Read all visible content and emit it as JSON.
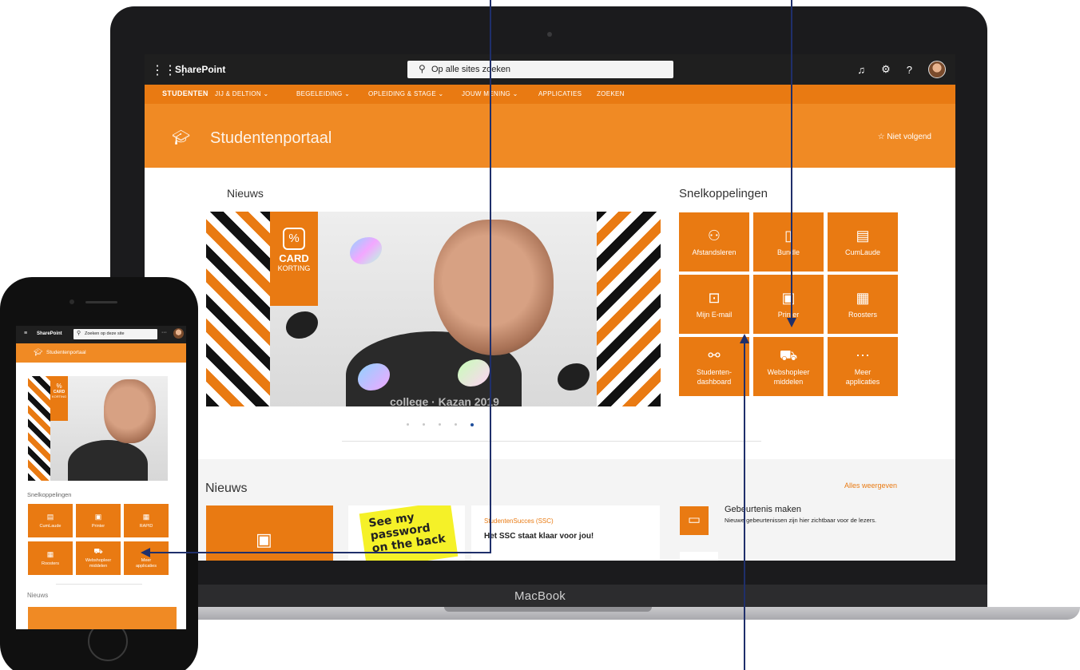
{
  "laptop": {
    "brand_label": "MacBook",
    "suitebar": {
      "waffle_icon": "waffle-icon",
      "app_name": "SharePoint",
      "search_placeholder": "Op alle sites zoeken",
      "icons": [
        "bell-icon",
        "gear-icon",
        "help-icon",
        "avatar"
      ]
    },
    "nav": {
      "items": [
        "STUDENTEN",
        "JIJ & DELTION",
        "BEGELEIDING",
        "OPLEIDING & STAGE",
        "JOUW MENING",
        "APPLICATIES",
        "ZOEKEN"
      ]
    },
    "site": {
      "title": "Studentenportaal",
      "follow_label": "Niet volgend"
    },
    "news_heading": "Nieuws",
    "carousel": {
      "badge_line1": "CARD",
      "badge_line2": "KORTING",
      "badge_symbol": "%",
      "caption": "college · Kazan 2019",
      "slide_count": 5,
      "active_slide": 5
    },
    "quicklinks": {
      "heading": "Snelkoppelingen",
      "tiles": [
        {
          "label": "Afstandsleren",
          "icon": "person-cap-icon"
        },
        {
          "label": "Bundle",
          "icon": "document-icon"
        },
        {
          "label": "CumLaude",
          "icon": "clipboard-icon"
        },
        {
          "label": "Mijn E-mail",
          "icon": "outlook-mail-icon"
        },
        {
          "label": "Printer",
          "icon": "printer-doc-icon"
        },
        {
          "label": "Roosters",
          "icon": "calendar-icon"
        },
        {
          "label": "Studenten-\ndashboard",
          "icon": "people-add-icon"
        },
        {
          "label": "Webshopleer\nmiddelen",
          "icon": "cart-icon"
        },
        {
          "label": "Meer\napplicaties",
          "icon": "more-icon"
        }
      ]
    },
    "lower": {
      "heading": "Nieuws",
      "see_all": "Alles weergeven",
      "sticky_note": "See my password on the back",
      "article": {
        "tag": "StudentenSucces (SSC)",
        "title": "Het SSC staat klaar voor jou!"
      },
      "event": {
        "title": "Gebeurtenis maken",
        "description": "Nieuwe gebeurtenissen zijn hier zichtbaar voor de lezers."
      }
    }
  },
  "phone": {
    "app_name": "SharePoint",
    "search_placeholder": "Zoeken op deze site",
    "site_title": "Studentenportaal",
    "badge_line1": "CARD",
    "badge_line2": "KORTING",
    "badge_symbol": "%",
    "quicklinks_heading": "Snelkoppelingen",
    "tiles": [
      {
        "label": "CumLaude",
        "icon": "clipboard-icon"
      },
      {
        "label": "Printer",
        "icon": "printer-doc-icon"
      },
      {
        "label": "RAPID",
        "icon": "calendar-icon"
      },
      {
        "label": "Roosters",
        "icon": "calendar-icon"
      },
      {
        "label": "Webshopleer\nmiddelen",
        "icon": "cart-icon"
      },
      {
        "label": "Meer\napplicaties",
        "icon": "more-icon"
      }
    ],
    "news_heading": "Nieuws"
  },
  "colors": {
    "brand_orange": "#e97a12",
    "suitebar": "#1f1f1f",
    "arrow": "#1f2f6b"
  }
}
